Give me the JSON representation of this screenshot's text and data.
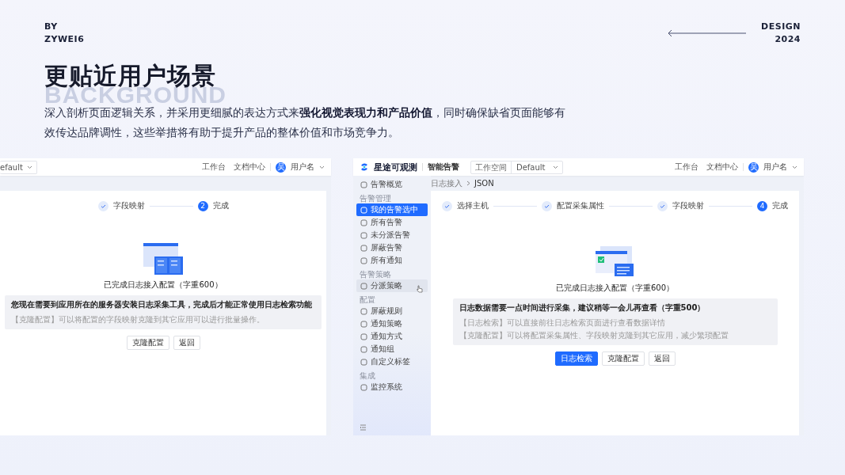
{
  "author": {
    "by": "BY",
    "name": "ZYWEI6"
  },
  "edition": {
    "label": "DESIGN",
    "year": "2024"
  },
  "title": "更贴近用户场景",
  "title_backdrop": "BACKGROUND",
  "intro": "深入剖析页面逻辑关系，并采用更细腻的表达方式来**强化视觉表现力和产品价值**，同时确保缺省页面能够有效传达品牌调性，这些举措将有助于提升产品的整体价值和市场竞争力。",
  "screens": [
    {
      "workspace_value": "efault",
      "nav_links": [
        "工作台",
        "文档中心"
      ],
      "user": {
        "avatar": "吴",
        "name": "用户名"
      },
      "steps": [
        {
          "label": "字段映射",
          "done": true
        },
        {
          "number": "2",
          "label": "完成",
          "done": false
        }
      ],
      "result_title": "已完成日志接入配置（字重600）",
      "notice_title": "您现在需要到应用所在的服务器安装日志采集工具，完成后才能正常使用日志检索功能",
      "notice_lines": [
        "【克隆配置】可以将配置的字段映射克隆到其它应用可以进行批量操作。"
      ],
      "buttons": [
        {
          "label": "克隆配置",
          "primary": false
        },
        {
          "label": "返回",
          "primary": false
        }
      ]
    },
    {
      "brand": "星途可观测",
      "module": "智能告警",
      "workspace_label": "工作空间",
      "workspace_value": "Default",
      "nav_links": [
        "工作台",
        "文档中心"
      ],
      "user": {
        "avatar": "吴",
        "name": "用户名"
      },
      "sidebar": [
        {
          "kind": "item",
          "label": "告警概览",
          "selected": false,
          "hovered": false
        },
        {
          "kind": "group",
          "label": "告警管理"
        },
        {
          "kind": "item",
          "label": "我的告警选中",
          "selected": true,
          "hovered": false
        },
        {
          "kind": "item",
          "label": "所有告警",
          "selected": false,
          "hovered": false
        },
        {
          "kind": "item",
          "label": "未分派告警",
          "selected": false,
          "hovered": false
        },
        {
          "kind": "item",
          "label": "屏蔽告警",
          "selected": false,
          "hovered": false
        },
        {
          "kind": "item",
          "label": "所有通知",
          "selected": false,
          "hovered": false
        },
        {
          "kind": "group",
          "label": "告警策略"
        },
        {
          "kind": "item",
          "label": "分派策略",
          "selected": false,
          "hovered": true
        },
        {
          "kind": "group",
          "label": "配置"
        },
        {
          "kind": "item",
          "label": "屏蔽规则",
          "selected": false,
          "hovered": false
        },
        {
          "kind": "item",
          "label": "通知策略",
          "selected": false,
          "hovered": false
        },
        {
          "kind": "item",
          "label": "通知方式",
          "selected": false,
          "hovered": false
        },
        {
          "kind": "item",
          "label": "通知组",
          "selected": false,
          "hovered": false
        },
        {
          "kind": "item",
          "label": "自定义标签",
          "selected": false,
          "hovered": false
        },
        {
          "kind": "group",
          "label": "集成"
        },
        {
          "kind": "item",
          "label": "监控系统",
          "selected": false,
          "hovered": false
        }
      ],
      "breadcrumb": [
        "日志接入",
        "JSON"
      ],
      "steps": [
        {
          "label": "选择主机",
          "done": true
        },
        {
          "label": "配置采集属性",
          "done": true
        },
        {
          "label": "字段映射",
          "done": true
        },
        {
          "number": "4",
          "label": "完成",
          "done": false
        }
      ],
      "result_title": "已完成日志接入配置（字重600）",
      "notice_title": "日志数据需要一点时间进行采集，建议稍等一会儿再查看（字重500）",
      "notice_lines": [
        "【日志检索】可以直接前往日志检索页面进行查看数据详情",
        "【克隆配置】可以将配置采集属性、字段映射克隆到其它应用，减少繁琐配置"
      ],
      "buttons": [
        {
          "label": "日志检索",
          "primary": true
        },
        {
          "label": "克隆配置",
          "primary": false
        },
        {
          "label": "返回",
          "primary": false
        }
      ]
    }
  ]
}
